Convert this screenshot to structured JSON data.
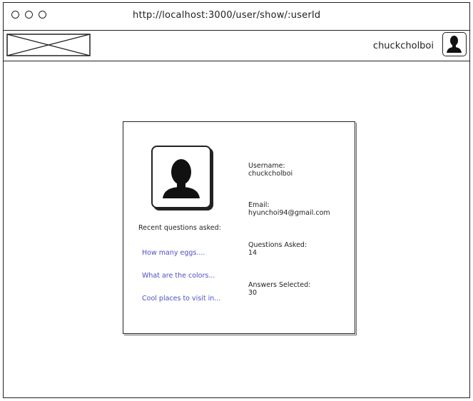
{
  "browser": {
    "url": "http://localhost:3000/user/show/:userId"
  },
  "navbar": {
    "username": "chuckcholboi",
    "avatar_icon": "user-silhouette-icon",
    "logo_icon": "image-placeholder-icon"
  },
  "profile": {
    "avatar_icon": "user-silhouette-icon",
    "recent_label": "Recent questions asked:",
    "recent_questions": [
      "How many eggs....",
      "What are the colors...",
      "Cool places to visit in..."
    ],
    "fields": [
      {
        "label": "Username:",
        "value": "chuckcholboi"
      },
      {
        "label": "Email:",
        "value": "hyunchoi94@gmail.com"
      },
      {
        "label": "Questions Asked:",
        "value": "14"
      },
      {
        "label": "Answers Selected:",
        "value": "30"
      }
    ],
    "link_color": "#4b4fc6"
  }
}
